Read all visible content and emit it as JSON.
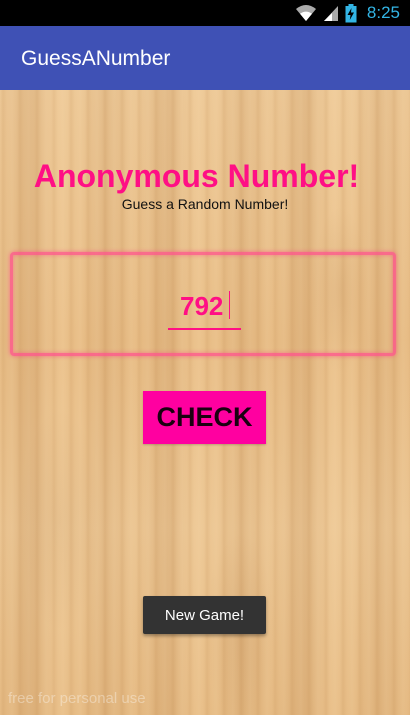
{
  "status_bar": {
    "time": "8:25",
    "icons": [
      "wifi-icon",
      "signal-icon",
      "battery-charging-icon"
    ]
  },
  "app_bar": {
    "title": "GuessANumber",
    "color": "#3f51b5"
  },
  "main": {
    "headline": "Anonymous Number!",
    "subline": "Guess a Random Number!",
    "guess_value": "792",
    "check_label": "CHECK",
    "new_game_label": "New Game!",
    "watermark": "free for personal use",
    "accent_color": "#ff0f85"
  }
}
